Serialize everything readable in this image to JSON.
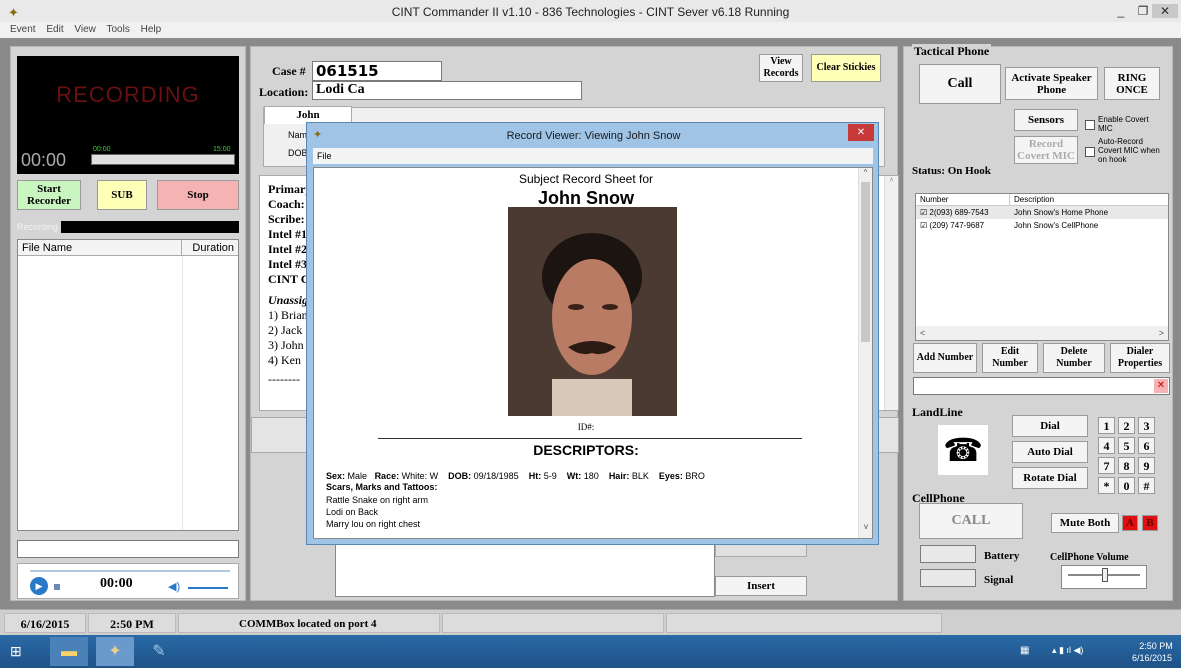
{
  "window": {
    "title": "CINT Commander II  v1.10   -  836 Technologies  - CINT Sever v6.18 Running",
    "minimize": "_",
    "restore": "❐",
    "close": "✕"
  },
  "menu": [
    "Event",
    "Edit",
    "View",
    "Tools",
    "Help"
  ],
  "recorder": {
    "recording_text": "RECORDING",
    "time": "00:00",
    "level_start": "00:00",
    "level_end": "15:00",
    "start_label": "Start Recorder",
    "sub_label": "SUB",
    "stop_label": "Stop",
    "recording_label": "Recording",
    "file_col": "File Name",
    "duration_col": "Duration",
    "player_time": "00:00"
  },
  "case": {
    "case_label": "Case #",
    "case_value": "061515",
    "location_label": "Location:",
    "location_value": "Lodi  Ca",
    "view_records": "View Records",
    "clear_stickies": "Clear Stickies",
    "tab_label": "John",
    "name_label": "Nam",
    "dob_label": "DOB",
    "team_lines": [
      "Primary",
      "Coach:",
      "Scribe:",
      "Intel #1",
      "Intel #2",
      "Intel #3",
      "CINT C"
    ],
    "unassigned": "Unassig",
    "unassigned_list": [
      "1) Brian",
      "2) Jack",
      "3) John",
      "4) Ken"
    ],
    "dashes": "--------",
    "insert_label": "Insert"
  },
  "dialog": {
    "title": "Record Viewer:  Viewing John Snow",
    "close": "✕",
    "menu_file": "File",
    "heading": "Subject Record Sheet for",
    "name": "John Snow",
    "id_label": "ID#:",
    "descriptors": "DESCRIPTORS:",
    "sex_label": "Sex:",
    "sex": "Male",
    "race_label": "Race:",
    "race": "White: W",
    "dob_label": "DOB:",
    "dob": "09/18/1985",
    "ht_label": "Ht:",
    "ht": "5-9",
    "wt_label": "Wt:",
    "wt": "180",
    "hair_label": "Hair:",
    "hair": "BLK",
    "eyes_label": "Eyes:",
    "eyes": "BRO",
    "smt_label": "Scars, Marks and Tattoos:",
    "smt": [
      "Rattle Snake on right arm",
      "Lodi on Back",
      "Marry lou on right chest"
    ]
  },
  "tactical": {
    "title": "Tactical Phone",
    "call": "Call",
    "activate_speaker": "Activate Speaker Phone",
    "ring_once": "RING ONCE",
    "sensors": "Sensors",
    "enable_covert": "Enable Covert MIC",
    "record_covert": "Record Covert MIC",
    "auto_record": "Auto-Record Covert MIC when on hook",
    "status": "Status:  On Hook",
    "number_col": "Number",
    "desc_col": "Description",
    "rows": [
      {
        "number": "2(093) 689-7543",
        "desc": "John Snow's Home Phone"
      },
      {
        "number": "(209) 747-9687",
        "desc": "John Snow's CellPhone"
      }
    ],
    "add_number": "Add Number",
    "edit_number": "Edit Number",
    "delete_number": "Delete Number",
    "dialer_props": "Dialer Properties"
  },
  "landline": {
    "title": "LandLine",
    "dial": "Dial",
    "auto_dial": "Auto Dial",
    "rotate_dial": "Rotate Dial",
    "keys": [
      "1",
      "2",
      "3",
      "4",
      "5",
      "6",
      "7",
      "8",
      "9",
      "*",
      "0",
      "#"
    ]
  },
  "cellphone": {
    "title": "CellPhone",
    "call": "CALL",
    "mute_both": "Mute Both",
    "a": "A",
    "b": "B",
    "battery": "Battery",
    "signal": "Signal",
    "volume": "CellPhone Volume"
  },
  "status": {
    "date": "6/16/2015",
    "time": "2:50 PM",
    "message": "COMMBox located on port 4"
  },
  "taskbar": {
    "clock_time": "2:50 PM",
    "clock_date": "6/16/2015"
  },
  "colors": {
    "accent_yellow": "#ffffb8",
    "green_btn": "#c8f5c0",
    "stop_pink": "#f6b3b3",
    "record_red": "#6a1010",
    "ab_red": "#e01010"
  }
}
